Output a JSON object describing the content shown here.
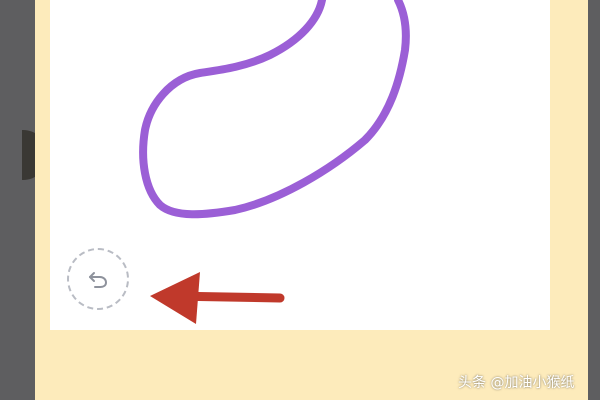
{
  "colors": {
    "backdrop": "#5e5e60",
    "panel": "#fdebbb",
    "canvas": "#ffffff",
    "stroke": "#9b5fd6",
    "arrow": "#c0392b",
    "undo_outline": "#b9bcc4",
    "undo_icon": "#8e929c"
  },
  "icons": {
    "undo": "undo-icon",
    "arrow": "red-arrow-pointer"
  },
  "watermark": {
    "text": "头条 @加油小猴纸"
  }
}
